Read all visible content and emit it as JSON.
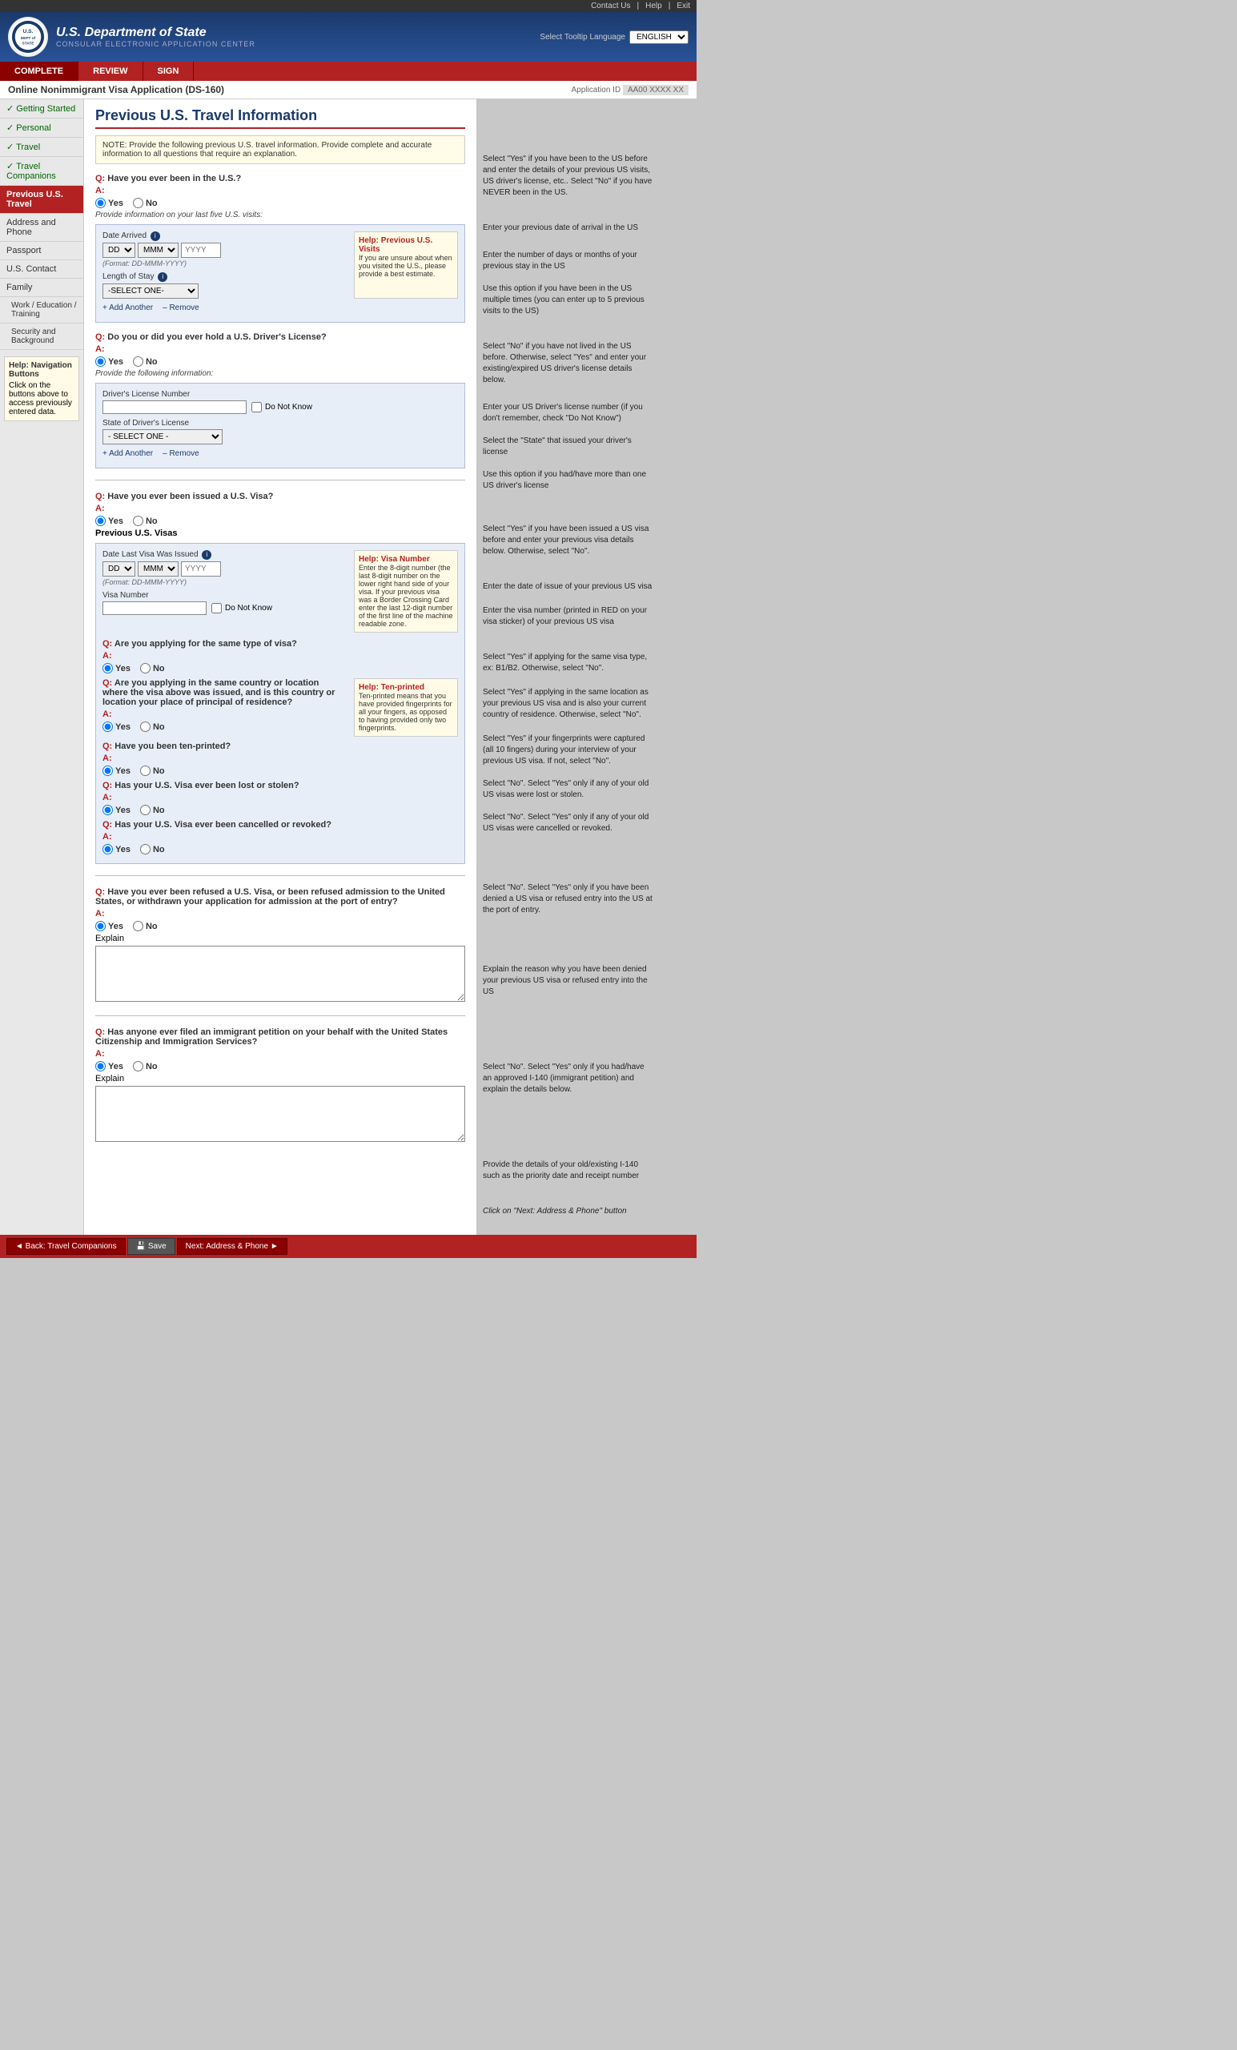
{
  "topbar": {
    "contact": "Contact Us",
    "help": "Help",
    "exit": "Exit"
  },
  "header": {
    "dept_line1": "U.S. Department of State",
    "dept_line2": "CONSULAR ELECTRONIC APPLICATION CENTER",
    "lang_label": "Select Tooltip Language",
    "lang_value": "ENGLISH"
  },
  "nav_tabs": [
    {
      "id": "complete",
      "label": "COMPLETE",
      "active": true
    },
    {
      "id": "review",
      "label": "REVIEW"
    },
    {
      "id": "sign",
      "label": "SIGN"
    }
  ],
  "app_header": {
    "title": "Online Nonimmigrant Visa Application (DS-160)",
    "app_id_label": "Application ID",
    "app_id_value": "AA00 XXXX XX"
  },
  "page_title": "Previous U.S. Travel Information",
  "note": "NOTE: Provide the following previous U.S. travel information. Provide complete and accurate information to all questions that require an explanation.",
  "sidebar": {
    "items": [
      {
        "label": "Getting Started",
        "completed": true
      },
      {
        "label": "Personal",
        "completed": true
      },
      {
        "label": "Travel",
        "completed": true
      },
      {
        "label": "Travel Companions",
        "completed": true
      },
      {
        "label": "Previous U.S. Travel",
        "active": true
      },
      {
        "label": "Address and Phone",
        "completed": false
      },
      {
        "label": "Passport",
        "completed": false
      },
      {
        "label": "U.S. Contact",
        "completed": false
      },
      {
        "label": "Family",
        "completed": false
      },
      {
        "label": "Work / Education / Training",
        "completed": false
      },
      {
        "label": "Security and Background",
        "completed": false
      }
    ],
    "help_title": "Help: Navigation Buttons",
    "help_text": "Click on the buttons above to access previously entered data."
  },
  "questions": {
    "q1": {
      "label": "Have you ever been in the U.S.?",
      "answer": "Yes",
      "options": [
        "Yes",
        "No"
      ],
      "sub_label": "Provide information on your last five U.S. visits:",
      "date_arrived_label": "Date Arrived",
      "date_format": "(Format: DD-MMM-YYYY)",
      "length_stay_label": "Length of Stay",
      "select_one": "-SELECT ONE-",
      "help_title": "Help: Previous U.S. Visits",
      "help_text": "If you are unsure about when you visited the U.S., please provide a best estimate.",
      "add_another": "+ Add Another",
      "remove": "– Remove"
    },
    "q2": {
      "label": "Do you or did you ever hold a U.S. Driver's License?",
      "answer": "Yes",
      "options": [
        "Yes",
        "No"
      ],
      "sub_label": "Provide the following information:",
      "dl_number_label": "Driver's License Number",
      "do_not_know": "Do Not Know",
      "state_label": "State of Driver's License",
      "state_select": "- SELECT ONE -",
      "add_another": "+ Add Another",
      "remove": "– Remove"
    },
    "q3": {
      "label": "Have you ever been issued a U.S. Visa?",
      "answer": "Yes",
      "options": [
        "Yes",
        "No"
      ],
      "sub_label": "Previous U.S. Visas",
      "date_issued_label": "Date Last Visa Was Issued",
      "date_format": "(Format: DD-MMM-YYYY)",
      "visa_number_label": "Visa Number",
      "do_not_know": "Do Not Know",
      "help_visa_title": "Help: Visa Number",
      "help_visa_text": "Enter the 8-digit number (the last 8-digit number on the lower right hand side of your visa. If your previous visa was a Border Crossing Card enter the last 12-digit number of the first line of the machine readable zone.",
      "same_type_label": "Are you applying for the same type of visa?",
      "same_type_answer": "Yes",
      "same_type_options": [
        "Yes",
        "No"
      ],
      "same_location_label": "Are you applying in the same country or location where the visa above was issued, and is this country or location your place of principal of residence?",
      "same_location_answer": "Yes",
      "same_location_options": [
        "Yes",
        "No"
      ],
      "help_ten_title": "Help: Ten-printed",
      "help_ten_text": "Ten-printed means that you have provided fingerprints for all your fingers, as opposed to having provided only two fingerprints.",
      "ten_printed_label": "Have you been ten-printed?",
      "ten_printed_answer": "Yes",
      "ten_printed_options": [
        "Yes",
        "No"
      ],
      "lost_label": "Has your U.S. Visa ever been lost or stolen?",
      "lost_answer": "Yes",
      "lost_options": [
        "Yes",
        "No"
      ],
      "cancelled_label": "Has your U.S. Visa ever been cancelled or revoked?",
      "cancelled_answer": "Yes",
      "cancelled_options": [
        "Yes",
        "No"
      ]
    },
    "q4": {
      "label": "Have you ever been refused a U.S. Visa, or been refused admission to the United States, or withdrawn your application for admission at the port of entry?",
      "answer": "Yes",
      "options": [
        "Yes",
        "No"
      ],
      "explain_label": "Explain"
    },
    "q5": {
      "label": "Has anyone ever filed an immigrant petition on your behalf with the United States Citizenship and Immigration Services?",
      "answer": "Yes",
      "options": [
        "Yes",
        "No"
      ],
      "explain_label": "Explain"
    }
  },
  "annotations": {
    "a1": "Select \"Yes\" if you have been to the US before and enter the details of your previous US visits, US driver's license, etc.. Select \"No\" if you have NEVER been in the US.",
    "a2": "Enter your previous date of arrival in the US",
    "a3": "Enter the number of days or months of your previous stay in the US",
    "a4": "Use this option if you have been in the US multiple times (you can enter up to 5 previous visits to the US)",
    "a5": "Select \"No\" if you have not lived in the US before. Otherwise, select \"Yes\" and enter your existing/expired US driver's license details below.",
    "a6": "Enter your US Driver's license number (if you don't remember, check \"Do Not Know\")",
    "a7": "Select the \"State\" that issued your driver's license",
    "a8": "Use this option if you had/have more than one US driver's license",
    "a9": "Select \"Yes\" if you have been issued a US visa before and enter your previous visa details below. Otherwise, select \"No\".",
    "a10": "Enter the date of issue of your previous US visa",
    "a11": "Enter the visa number (printed in RED on your visa sticker) of your previous US visa",
    "a12": "Select \"Yes\" if applying for the same visa type, ex: B1/B2. Otherwise, select \"No\".",
    "a13": "Select \"Yes\" if applying in the same location as your previous US visa and is also your current country of residence. Otherwise, select \"No\".",
    "a14": "Select \"Yes\" if your fingerprints were captured (all 10 fingers) during your interview of your previous US visa. If not, select \"No\".",
    "a15": "Select \"No\". Select \"Yes\" only if any of your old US visas were lost or stolen.",
    "a16": "Select \"No\". Select \"Yes\" only if any of your old US visas were cancelled or revoked.",
    "a17": "Select \"No\". Select \"Yes\" only if you have been denied a US visa or refused entry into the US at the port of entry.",
    "a18": "Explain the reason why you have been denied your previous US visa or refused entry into the US",
    "a19": "Select \"No\". Select \"Yes\" only if you had/have an approved I-140 (immigrant petition) and explain the details below.",
    "a20": "Provide the details of your old/existing I-140 such as the priority date and receipt number",
    "a21": "Click on \"Next: Address & Phone\" button"
  },
  "bottom_nav": {
    "back_label": "◄ Back: Travel Companions",
    "save_label": "💾 Save",
    "next_label": "Next: Address & Phone ►"
  }
}
